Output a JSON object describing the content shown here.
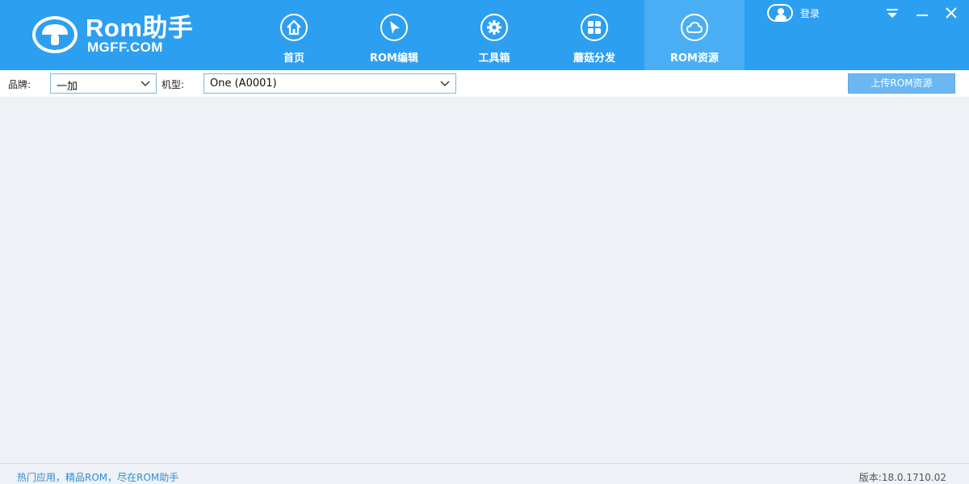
{
  "app": {
    "logo_main": "Rom助手",
    "logo_sub": "MGFF.COM"
  },
  "nav": {
    "items": [
      {
        "label": "首页",
        "icon": "home-icon",
        "active": false
      },
      {
        "label": "ROM编辑",
        "icon": "cursor-arrow-icon",
        "active": false
      },
      {
        "label": "工具箱",
        "icon": "gear-icon",
        "active": false
      },
      {
        "label": "蘑菇分发",
        "icon": "grid-icon",
        "active": false
      },
      {
        "label": "ROM资源",
        "icon": "cloud-icon",
        "active": true
      }
    ]
  },
  "header_right": {
    "login_label": "登录",
    "login_icon": "user-icon"
  },
  "toolbar": {
    "brand_label": "品牌:",
    "brand_value": "一加",
    "model_label": "机型:",
    "model_value": "One (A0001)",
    "upload_button": "上传ROM资源"
  },
  "status": {
    "left_text": "热门应用，精品ROM，尽在ROM助手",
    "version_text": "版本:18.0.1710.02"
  },
  "colors": {
    "header_bg": "#2d9ff1",
    "nav_active_bg": "#4aaef5",
    "content_bg": "#eef1f5",
    "upload_btn_bg": "#6cb7f2",
    "status_link": "#2d8fd6"
  }
}
